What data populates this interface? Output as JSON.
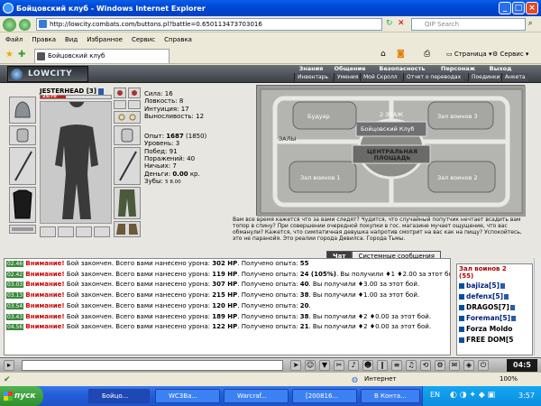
{
  "window": {
    "title": "Бойцовский клуб - Windows Internet Explorer"
  },
  "address": {
    "url": "http://lowcity.combats.com/buttons.pl?battle=0.650113473703016",
    "search_placeholder": "QIP Search"
  },
  "menu": [
    "Файл",
    "Правка",
    "Вид",
    "Избранное",
    "Сервис",
    "Справка"
  ],
  "toolbar": {
    "tab_label": "Бойцовский клуб",
    "page_label": "Страница",
    "service_label": "Сервис"
  },
  "game": {
    "logo": "LOWCITY",
    "nav_top": [
      "Знания",
      "Общение",
      "Безопасность",
      "Персонаж",
      "Выход"
    ],
    "nav_sub": [
      "Инвентарь",
      "Умения",
      "Мой Скролл",
      "Отчет о переводах",
      "Поединки",
      "Анкета"
    ],
    "character": {
      "name": "JESTERHEAD",
      "level": "[3]",
      "hp": "25/70",
      "hp_fraction": 0.36
    },
    "stats": [
      {
        "label": "Сила:",
        "value": "16"
      },
      {
        "label": "Ловкость:",
        "value": "8"
      },
      {
        "label": "Интуиция:",
        "value": "17"
      },
      {
        "label": "Выносливость:",
        "value": "12"
      }
    ],
    "exp": {
      "label": "Опыт:",
      "value": "1687",
      "next": "(1850)"
    },
    "progress": [
      {
        "label": "Уровень:",
        "value": "3"
      },
      {
        "label": "Побед:",
        "value": "91"
      },
      {
        "label": "Поражений:",
        "value": "40"
      },
      {
        "label": "Ничьих:",
        "value": "7"
      }
    ],
    "money": {
      "label": "Деньги:",
      "value": "0.00",
      "unit": "кр."
    },
    "teeth": {
      "label": "Зубы:",
      "value": "5 8.00"
    },
    "map": {
      "labels": [
        "Будуар",
        "Зал воинов 3",
        "2 ЭТАЖ",
        "Бойцовский Клуб",
        "ЗАЛЫ",
        "ЦЕНТРАЛЬНАЯ ПЛОЩАДЬ",
        "Зал воинов 1",
        "Зал воинов 2"
      ]
    },
    "flavor_text": "Вам все время кажется что за вами следят? Чудится, что случайный попутчик нечтает всадить вам топор в спину? При совершении очередной покупки в гос. магазине мучает ощущение, что вас обманули? Кажется, что симпатичная девушка напротив смотрит на вас как на пищу? Успокойтесь, это не паранойя. Это реалии города Девилса. Города Тьмы.",
    "chat_tabs": [
      "Чат",
      "Системные сообщения"
    ],
    "chat": [
      {
        "time": "02.46",
        "msg": "Внимание!",
        "rest": " Бой закончен. Всего вами нанесено урона: ",
        "dmg": "302 HP",
        "rest2": ". Получено опыта: ",
        "exp": "55",
        "tail": ""
      },
      {
        "time": "02.42",
        "msg": "Внимание!",
        "rest": " Бой закончен. Всего вами нанесено урона: ",
        "dmg": "119 HP",
        "rest2": ". Получено опыта: ",
        "exp": "24 (105%)",
        "tail": ". Вы получили ♦1 ♦2.00 за этот бой."
      },
      {
        "time": "03.03",
        "msg": "Внимание!",
        "rest": " Бой закончен. Всего вами нанесено урона: ",
        "dmg": "307 HP",
        "rest2": ". Получено опыта: ",
        "exp": "40",
        "tail": ". Вы получили ♦3.00 за этот бой."
      },
      {
        "time": "03.13",
        "msg": "Внимание!",
        "rest": " Бой закончен. Всего вами нанесено урона: ",
        "dmg": "215 HP",
        "rest2": ". Получено опыта: ",
        "exp": "38",
        "tail": ". Вы получили ♦1.00 за этот бой."
      },
      {
        "time": "03.54",
        "msg": "Внимание!",
        "rest": " Бой закончен. Всего вами нанесено урона: ",
        "dmg": "120 HP",
        "rest2": ". Получено опыта: ",
        "exp": "20",
        "tail": "."
      },
      {
        "time": "03.43",
        "msg": "Внимание!",
        "rest": " Бой закончен. Всего вами нанесено урона: ",
        "dmg": "189 HP",
        "rest2": ". Получено опыта: ",
        "exp": "38",
        "tail": ". Вы получили ♦2 ♦0.00 за этот бой."
      },
      {
        "time": "04.56",
        "msg": "Внимание!",
        "rest": " Бой закончен. Всего вами нанесено урона: ",
        "dmg": "122 HP",
        "rest2": ". Получено опыта: ",
        "exp": "21",
        "tail": ". Вы получили ♦2 ♦0.00 за этот бой."
      }
    ],
    "roster": {
      "title": "Зал воинов 2",
      "count": "(55)",
      "players": [
        "bajiza[5]",
        "defenx[5]",
        "DRAGOS[7]",
        "Foreman[5]",
        "Forza Moldo",
        "FREE DOM[5"
      ]
    },
    "clock": "04:5"
  },
  "status": {
    "zone": "Интернет",
    "zoom": "100%"
  },
  "taskbar": {
    "start": "пуск",
    "tasks": [
      "Бойцо...",
      "WC3Ba...",
      "Warcraf...",
      "[200816...",
      "В Конта..."
    ],
    "lang": "EN",
    "time": "3:57"
  }
}
